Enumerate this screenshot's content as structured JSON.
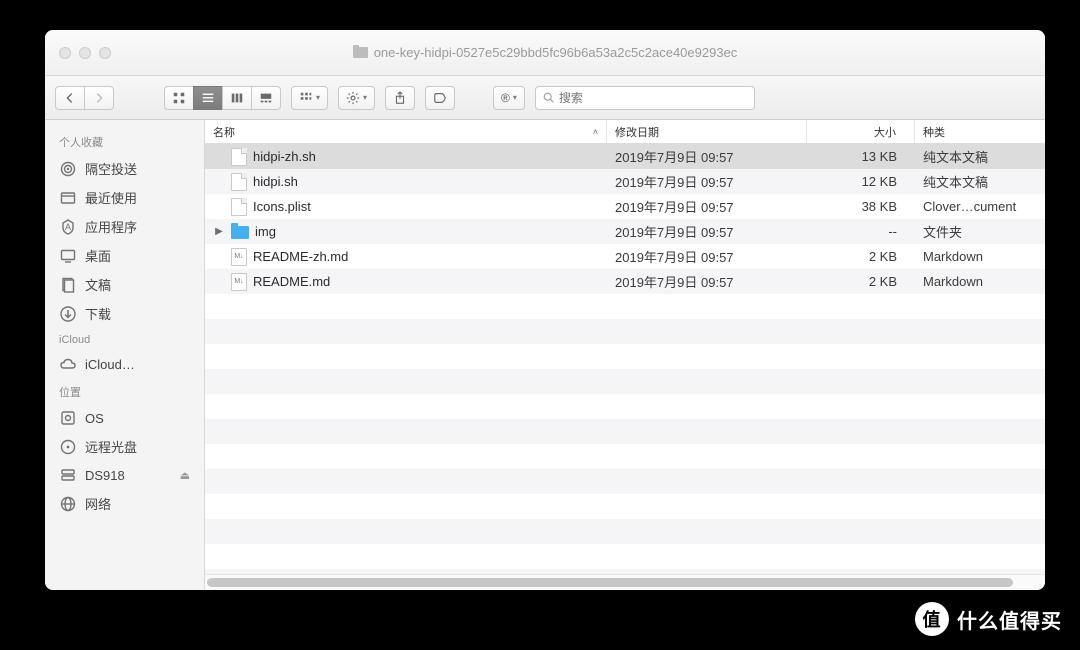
{
  "window": {
    "title": "one-key-hidpi-0527e5c29bbd5fc96b6a53a2c5c2ace40e9293ec"
  },
  "toolbar": {
    "search_placeholder": "搜索",
    "registered_mark": "®"
  },
  "sidebar": {
    "sections": [
      {
        "title": "个人收藏",
        "items": [
          {
            "icon": "airdrop",
            "label": "隔空投送"
          },
          {
            "icon": "recents",
            "label": "最近使用"
          },
          {
            "icon": "apps",
            "label": "应用程序"
          },
          {
            "icon": "desktop",
            "label": "桌面"
          },
          {
            "icon": "documents",
            "label": "文稿"
          },
          {
            "icon": "downloads",
            "label": "下载"
          }
        ]
      },
      {
        "title": "iCloud",
        "items": [
          {
            "icon": "icloud",
            "label": "iCloud…"
          }
        ]
      },
      {
        "title": "位置",
        "items": [
          {
            "icon": "disk",
            "label": "OS"
          },
          {
            "icon": "remotedisk",
            "label": "远程光盘"
          },
          {
            "icon": "nas",
            "label": "DS918",
            "eject": true
          },
          {
            "icon": "network",
            "label": "网络"
          }
        ]
      }
    ]
  },
  "columns": {
    "name": "名称",
    "date": "修改日期",
    "size": "大小",
    "kind": "种类"
  },
  "files": [
    {
      "name": "hidpi-zh.sh",
      "date": "2019年7月9日 09:57",
      "size": "13 KB",
      "kind": "纯文本文稿",
      "type": "doc",
      "selected": true,
      "expandable": false
    },
    {
      "name": "hidpi.sh",
      "date": "2019年7月9日 09:57",
      "size": "12 KB",
      "kind": "纯文本文稿",
      "type": "doc",
      "selected": false,
      "expandable": false
    },
    {
      "name": "Icons.plist",
      "date": "2019年7月9日 09:57",
      "size": "38 KB",
      "kind": "Clover…cument",
      "type": "doc",
      "selected": false,
      "expandable": false
    },
    {
      "name": "img",
      "date": "2019年7月9日 09:57",
      "size": "--",
      "kind": "文件夹",
      "type": "folder",
      "selected": false,
      "expandable": true
    },
    {
      "name": "README-zh.md",
      "date": "2019年7月9日 09:57",
      "size": "2 KB",
      "kind": "Markdown",
      "type": "md",
      "selected": false,
      "expandable": false
    },
    {
      "name": "README.md",
      "date": "2019年7月9日 09:57",
      "size": "2 KB",
      "kind": "Markdown",
      "type": "md",
      "selected": false,
      "expandable": false
    }
  ],
  "watermark": {
    "badge": "值",
    "text": "什么值得买"
  }
}
